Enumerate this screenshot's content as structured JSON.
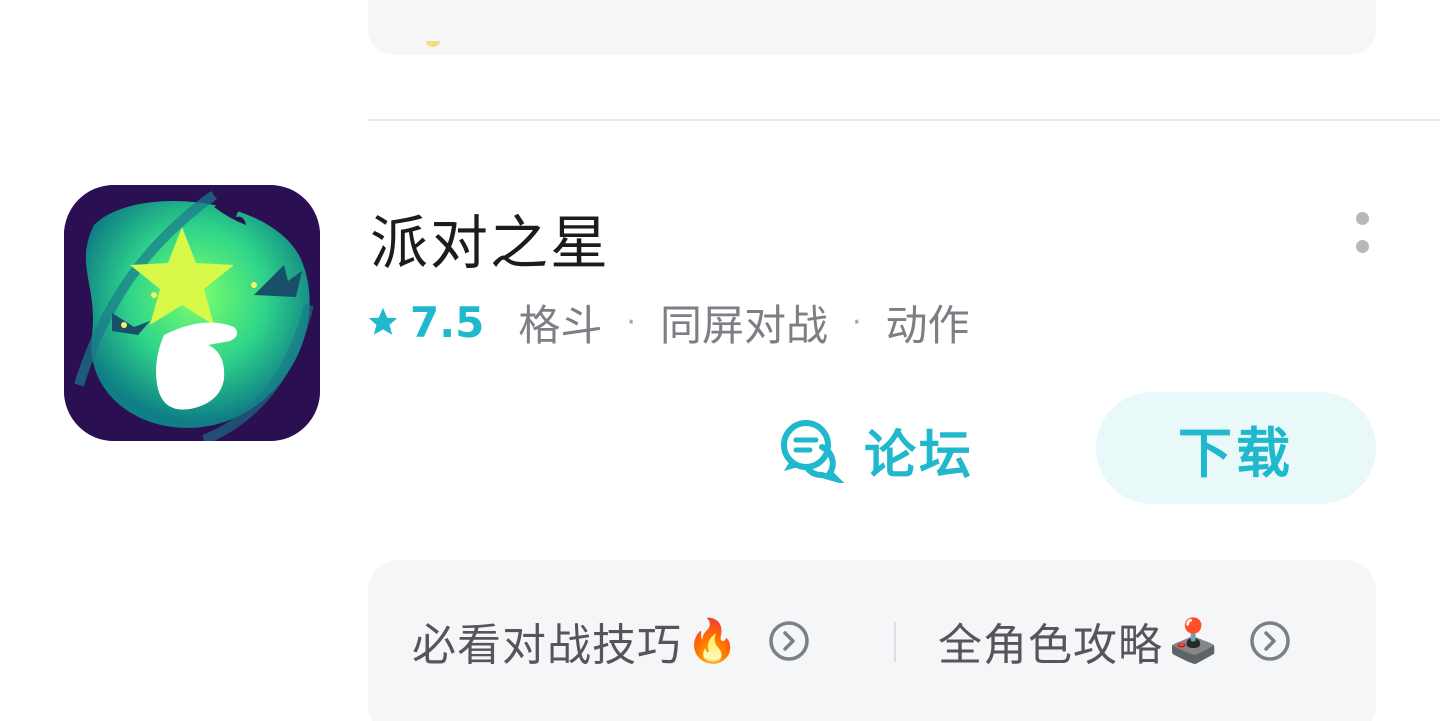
{
  "app": {
    "title": "派对之星",
    "rating": "7.5",
    "tags": [
      "格斗",
      "同屏对战",
      "动作"
    ],
    "separator": "·",
    "icon": "party-star-app-icon"
  },
  "actions": {
    "forum_label": "论坛",
    "download_label": "下载"
  },
  "guides": [
    {
      "label": "必看对战技巧",
      "emoji": "🔥"
    },
    {
      "label": "全角色攻略",
      "emoji": "🕹️"
    }
  ],
  "colors": {
    "accent": "#1fb8cc",
    "download_bg": "#e9f8f9",
    "card_bg": "#f5f6f8",
    "title_text": "#1c1c1e",
    "meta_text": "#7c7f84"
  },
  "icons": {
    "rating": "star-icon",
    "forum": "chat-bubble-icon",
    "more": "more-vertical-icon",
    "guide_arrow": "chevron-right-circle-icon"
  }
}
